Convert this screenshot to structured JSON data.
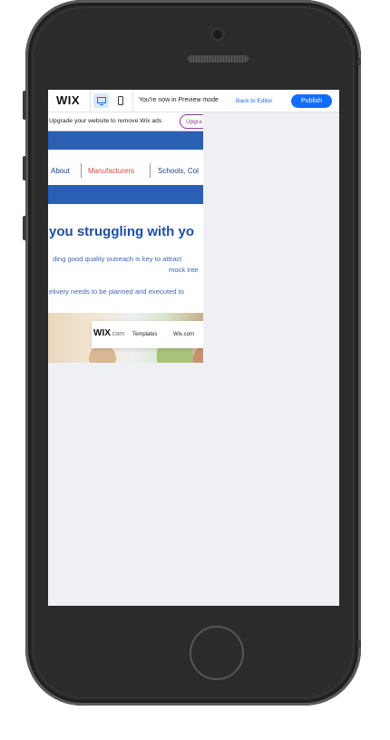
{
  "editor_bar": {
    "logo": "WIX",
    "preview_notice": "You're now in Preview mode",
    "back_to_editor": "Back to Editor",
    "publish": "Publish",
    "desktop_icon": "desktop-icon",
    "mobile_icon": "mobile-icon"
  },
  "banner": {
    "text": "Upgrade your website to remove Wix ads",
    "button": "Upgra"
  },
  "nav": {
    "items": [
      "About",
      "Manufacturers",
      "Schools, Col"
    ],
    "active_color": "#e0463a",
    "color": "#1a3f8a"
  },
  "content": {
    "headline": "you struggling with yo",
    "line1": "ding good quality outreach is key to attract",
    "line2": "mock inte",
    "line3": "elivery needs to be planned and executed to"
  },
  "wix_ad": {
    "logo": "WIX",
    "logo_suffix": ".com",
    "items": [
      "Templates",
      "Wix.com"
    ]
  },
  "colors": {
    "brand_blue": "#2b5fb3",
    "publish_blue": "#116dff",
    "upgrade_purple": "#8a3d8f"
  }
}
